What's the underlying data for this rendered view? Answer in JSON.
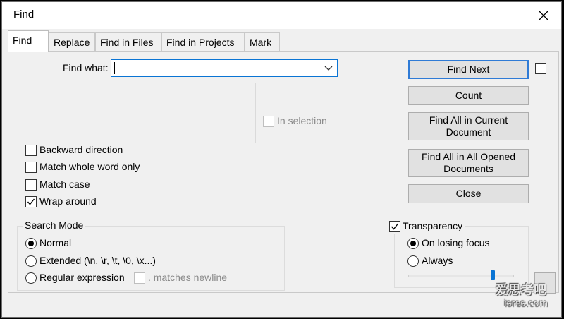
{
  "window": {
    "title": "Find"
  },
  "tabs": [
    "Find",
    "Replace",
    "Find in Files",
    "Find in Projects",
    "Mark"
  ],
  "find": {
    "label": "Find what:",
    "value": "",
    "in_selection": "In selection"
  },
  "buttons": {
    "find_next": "Find Next",
    "count": "Count",
    "find_all_current": [
      "Find All in Current",
      "Document"
    ],
    "find_all_opened": [
      "Find All in All Opened",
      "Documents"
    ],
    "close": "Close"
  },
  "options": [
    {
      "label": "Backward direction",
      "checked": false
    },
    {
      "label": "Match whole word only",
      "checked": false
    },
    {
      "label": "Match case",
      "checked": false
    },
    {
      "label": "Wrap around",
      "checked": true
    }
  ],
  "search_mode": {
    "title": "Search Mode",
    "normal": "Normal",
    "extended": "Extended (\\n, \\r, \\t, \\0, \\x...)",
    "regex": "Regular expression",
    "matches_newline": ". matches newline",
    "selected": "Normal"
  },
  "transparency": {
    "label": "Transparency",
    "checked": true,
    "on_losing_focus": "On losing focus",
    "always": "Always",
    "selected": "On losing focus",
    "level": 0.8
  },
  "watermark": {
    "line1": "爱思考吧",
    "line2": "isres.com"
  }
}
